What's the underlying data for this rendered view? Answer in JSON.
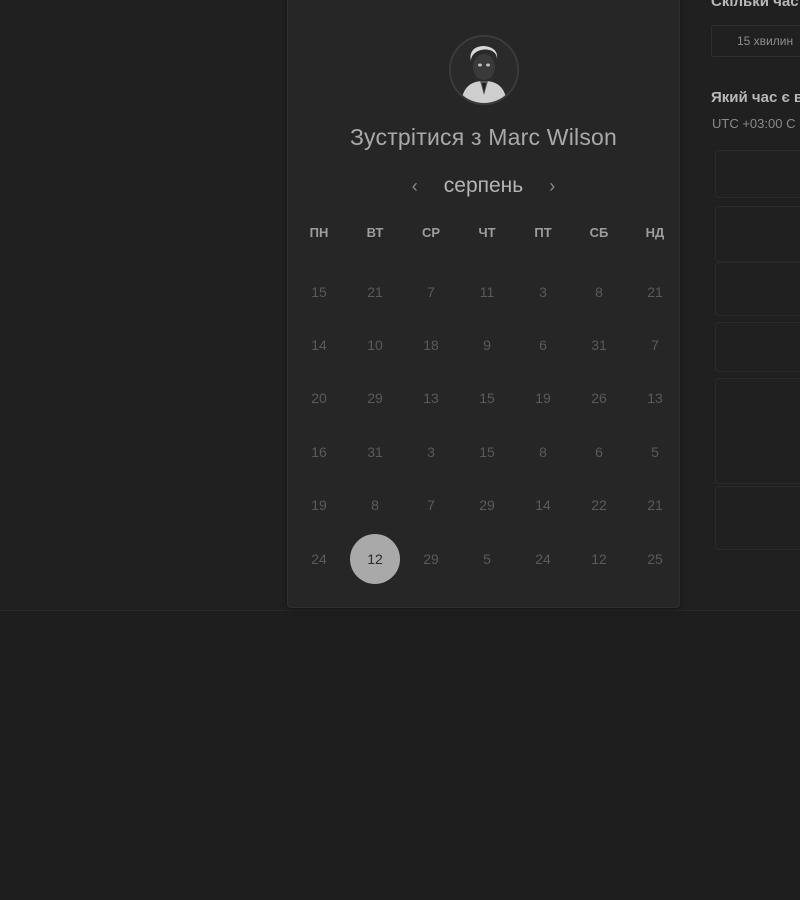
{
  "scheduler": {
    "title": "Зустрітися з Marc Wilson",
    "month": "серпень",
    "prev_icon": "chevron-left-icon",
    "next_icon": "chevron-right-icon",
    "weekdays": [
      "ПН",
      "ВТ",
      "СР",
      "ЧТ",
      "ПТ",
      "СБ",
      "НД"
    ],
    "days": [
      [
        "15",
        "21",
        "7",
        "11",
        "3",
        "8",
        "21"
      ],
      [
        "14",
        "10",
        "18",
        "9",
        "6",
        "31",
        "7"
      ],
      [
        "20",
        "29",
        "13",
        "15",
        "19",
        "26",
        "13"
      ],
      [
        "16",
        "31",
        "3",
        "15",
        "8",
        "6",
        "5"
      ],
      [
        "19",
        "8",
        "7",
        "29",
        "14",
        "22",
        "21"
      ],
      [
        "24",
        "12",
        "29",
        "5",
        "24",
        "12",
        "25"
      ]
    ],
    "selected_day": "12"
  },
  "right_panel": {
    "duration_heading": "Скільки час",
    "duration_value": "15 хвилин",
    "timezone_heading": "Який час є в",
    "timezone_value": "UTC +03:00 С"
  }
}
